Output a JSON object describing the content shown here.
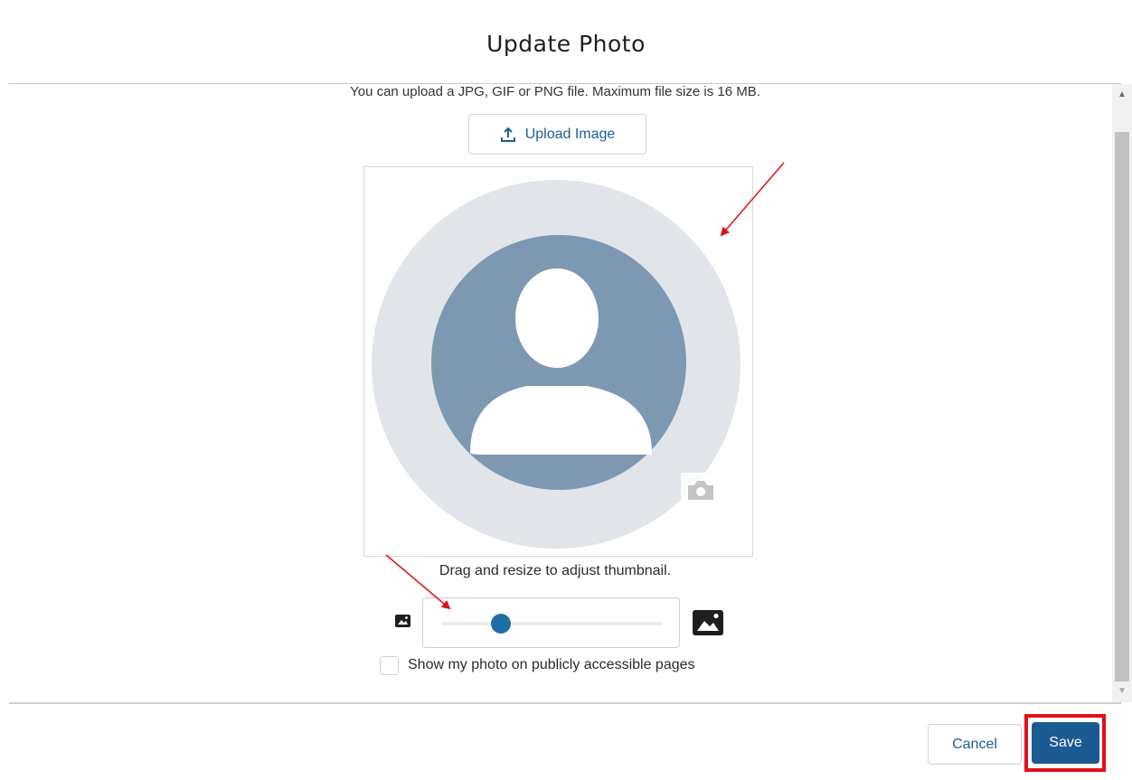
{
  "modal": {
    "title": "Update Photo",
    "info_text": "You can upload a JPG, GIF or PNG file. Maximum file size is 16 MB.",
    "upload_button_label": "Upload Image",
    "drag_hint": "Drag and resize to adjust thumbnail.",
    "zoom_level": 0.27,
    "show_public_label": "Show my photo on publicly accessible pages",
    "show_public_checked": false
  },
  "footer": {
    "cancel_label": "Cancel",
    "save_label": "Save"
  },
  "icons": {
    "upload": "upload-icon",
    "camera": "camera-icon",
    "avatar": "avatar-placeholder-icon",
    "zoom_out": "image-small-icon",
    "zoom_in": "image-large-icon"
  },
  "colors": {
    "accent": "#1c5a94",
    "link": "#1b5f95",
    "highlight": "#e0101a",
    "avatar_bg": "#7f98b1",
    "crop_circle": "#e1e5ea"
  }
}
